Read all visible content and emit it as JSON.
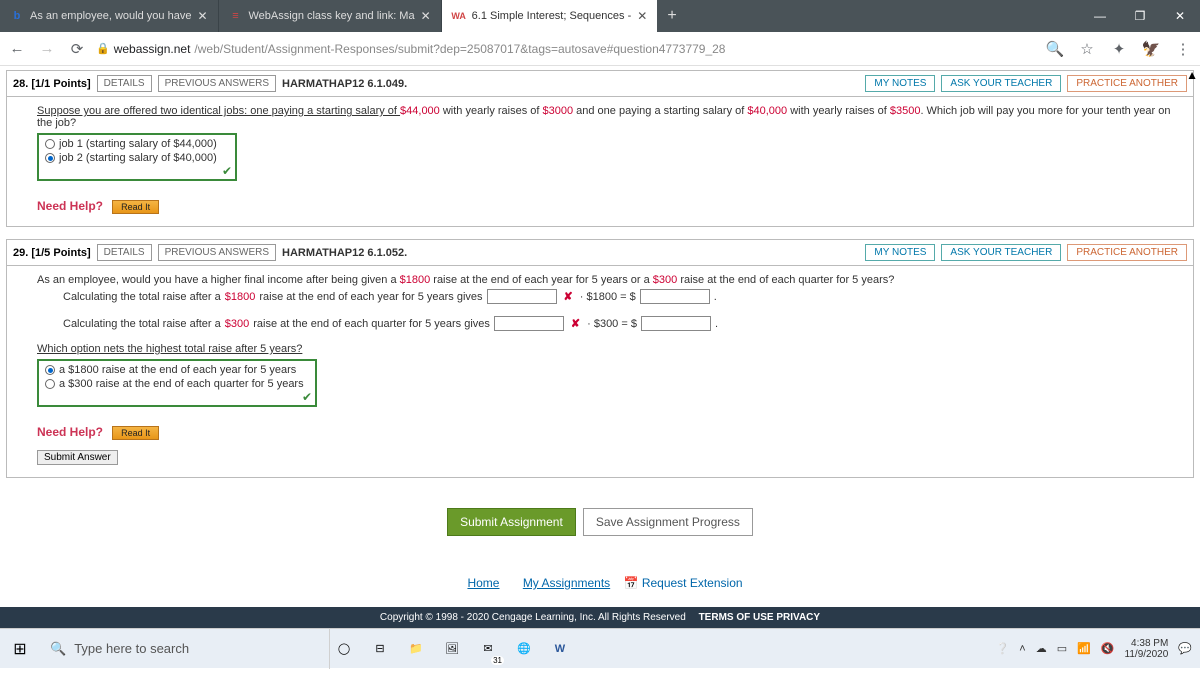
{
  "tabs": [
    {
      "title": "As an employee, would you have",
      "icon": "b",
      "iconColor": "#2a6fd6"
    },
    {
      "title": "WebAssign class key and link: Ma",
      "icon": "≡",
      "iconColor": "#d04545"
    },
    {
      "title": "6.1 Simple Interest; Sequences -",
      "icon": "WA",
      "iconColor": "#d04545"
    }
  ],
  "url": {
    "host": "webassign.net",
    "path": "/web/Student/Assignment-Responses/submit?dep=25087017&tags=autosave#question4773779_28"
  },
  "q28": {
    "header": "28.  [1/1 Points]",
    "ref": "HARMATHAP12 6.1.049.",
    "details": "DETAILS",
    "prev": "PREVIOUS ANSWERS",
    "mynotes": "MY NOTES",
    "askteacher": "ASK YOUR TEACHER",
    "practice": "PRACTICE ANOTHER",
    "text1": "Suppose you are offered two identical jobs: one paying a starting salary of ",
    "v1": "$44,000",
    "text2": " with yearly raises of ",
    "v2": "$3000",
    "text3": " and one paying a starting salary of ",
    "v3": "$40,000",
    "text4": " with yearly raises of ",
    "v4": "$3500",
    "text5": ". Which job will pay you more for your tenth year on the job?",
    "opt1": "job 1 (starting salary of $44,000)",
    "opt2": "job 2 (starting salary of $40,000)",
    "needhelp": "Need Help?",
    "readit": "Read It"
  },
  "q29": {
    "header": "29.  [1/5 Points]",
    "ref": "HARMATHAP12 6.1.052.",
    "details": "DETAILS",
    "prev": "PREVIOUS ANSWERS",
    "mynotes": "MY NOTES",
    "askteacher": "ASK YOUR TEACHER",
    "practice": "PRACTICE ANOTHER",
    "text1": "As an employee, would you have a higher final income after being given a ",
    "v1": "$1800",
    "text2": " raise at the end of each year for 5 years or a ",
    "v2": "$300",
    "text3": " raise at the end of each quarter for 5 years?",
    "line2a": "Calculating the total raise after a ",
    "line2b": "$1800",
    "line2c": " raise at the end of each year for 5 years gives",
    "mult1": "· $1800 = $",
    "line3a": "Calculating the total raise after a ",
    "line3b": "$300",
    "line3c": " raise at the end of each quarter for 5 years gives",
    "mult2": "· $300 = $",
    "whichq": "Which option nets the highest total raise after 5 years?",
    "opt1": "a $1800 raise at the end of each year for 5 years",
    "opt2": "a $300 raise at the end of each quarter for 5 years",
    "needhelp": "Need Help?",
    "readit": "Read It",
    "submitans": "Submit Answer"
  },
  "submit": {
    "big": "Submit Assignment",
    "save": "Save Assignment Progress"
  },
  "botlinks": {
    "home": "Home",
    "myasg": "My Assignments",
    "reqext": "Request Extension"
  },
  "copyright": {
    "l1": "Copyright © 1998 - 2020 Cengage Learning, Inc. All Rights Reserved",
    "l2": "TERMS OF USE   PRIVACY"
  },
  "taskbar": {
    "search": "Type here to search",
    "time": "4:38 PM",
    "date": "11/9/2020",
    "badge": "31"
  }
}
